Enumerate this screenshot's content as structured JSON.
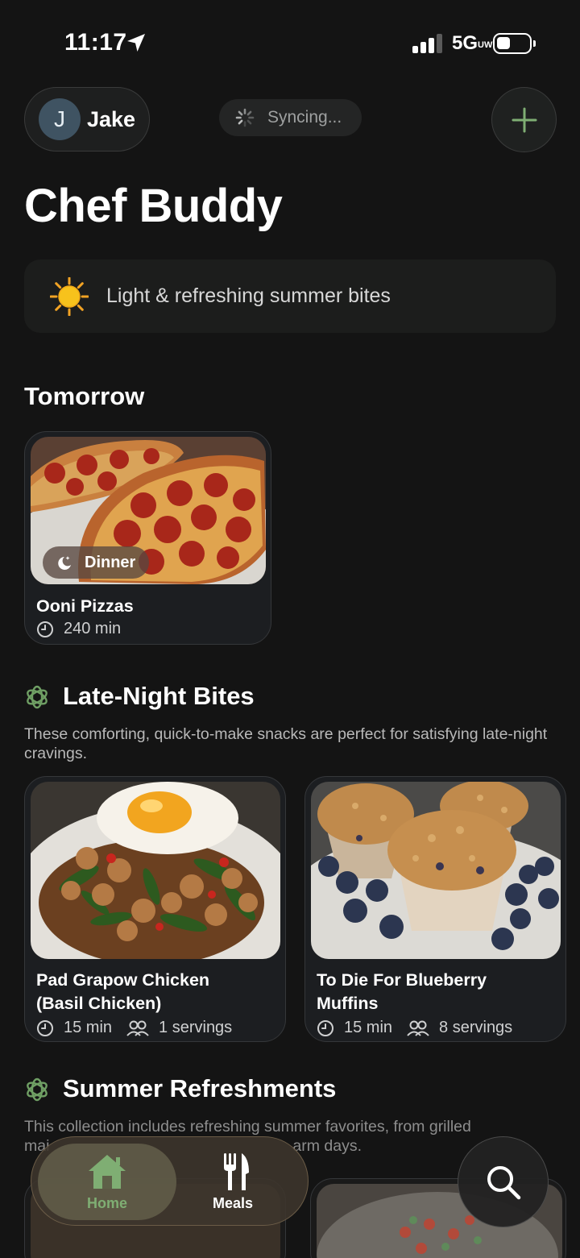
{
  "status_bar": {
    "time": "11:17",
    "network": "5G",
    "network_sub": "UW"
  },
  "header": {
    "avatar_initial": "J",
    "user_name": "Jake",
    "sync_text": "Syncing...",
    "add_icon": "plus-icon"
  },
  "page_title": "Chef Buddy",
  "banner": {
    "icon": "sun-icon",
    "text": "Light & refreshing summer bites"
  },
  "tomorrow": {
    "title": "Tomorrow",
    "card": {
      "badge": "Dinner",
      "badge_icon": "moon-icon",
      "name": "Ooni Pizzas",
      "time": "240 min"
    }
  },
  "late_night": {
    "title": "Late-Night Bites",
    "description": "These comforting, quick-to-make snacks are perfect for satisfying late-night cravings.",
    "cards": [
      {
        "name_line1": "Pad Grapow Chicken",
        "name_line2": "(Basil Chicken)",
        "time": "15 min",
        "servings": "1 servings"
      },
      {
        "name_line1": "To Die For Blueberry",
        "name_line2": "Muffins",
        "time": "15 min",
        "servings": "8 servings"
      }
    ]
  },
  "summer": {
    "title": "Summer Refreshments",
    "description_line1": "This collection includes refreshing summer favorites, from grilled",
    "description_line2_start": "mai",
    "description_line2_end": "arm days."
  },
  "bottom_nav": {
    "home_label": "Home",
    "meals_label": "Meals",
    "search_icon": "search-icon"
  },
  "colors": {
    "background": "#141414",
    "accent_green": "#7fae73",
    "card_bg": "#1c1e21"
  }
}
